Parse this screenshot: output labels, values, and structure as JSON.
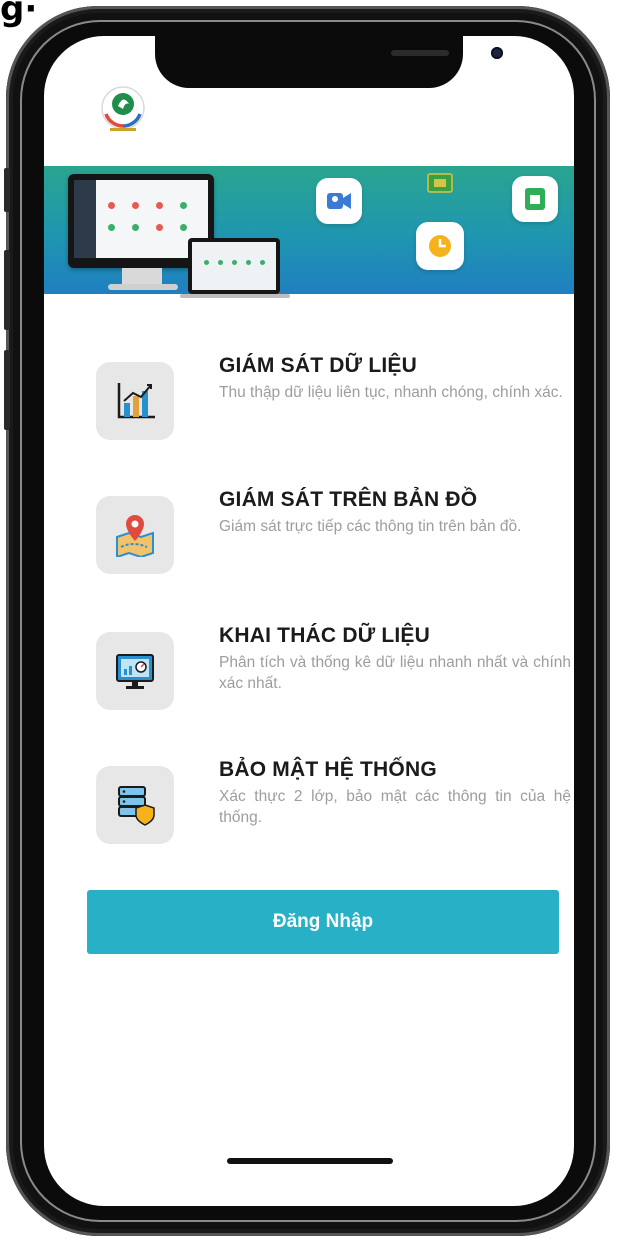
{
  "features": [
    {
      "icon": "chart-icon",
      "title": "GIÁM SÁT DỮ LIỆU",
      "desc": "Thu thập dữ liệu liên tục, nhanh chóng, chính xác."
    },
    {
      "icon": "map-pin-icon",
      "title": "GIÁM SÁT TRÊN BẢN ĐỒ",
      "desc": "Giám sát trực tiếp các thông tin trên bản đồ."
    },
    {
      "icon": "monitor-analytics-icon",
      "title": "KHAI THÁC DỮ LIỆU",
      "desc": "Phân tích và thống kê dữ liệu nhanh nhất và chính xác nhất."
    },
    {
      "icon": "database-shield-icon",
      "title": "BẢO MẬT HỆ THỐNG",
      "desc": "Xác thực 2 lớp, bảo mật các thông tin của hệ thống."
    }
  ],
  "login_button": {
    "label": "Đăng Nhập"
  },
  "colors": {
    "accent": "#27b0c6",
    "banner_top": "#2aa58f",
    "banner_bottom": "#1f7fc0"
  }
}
